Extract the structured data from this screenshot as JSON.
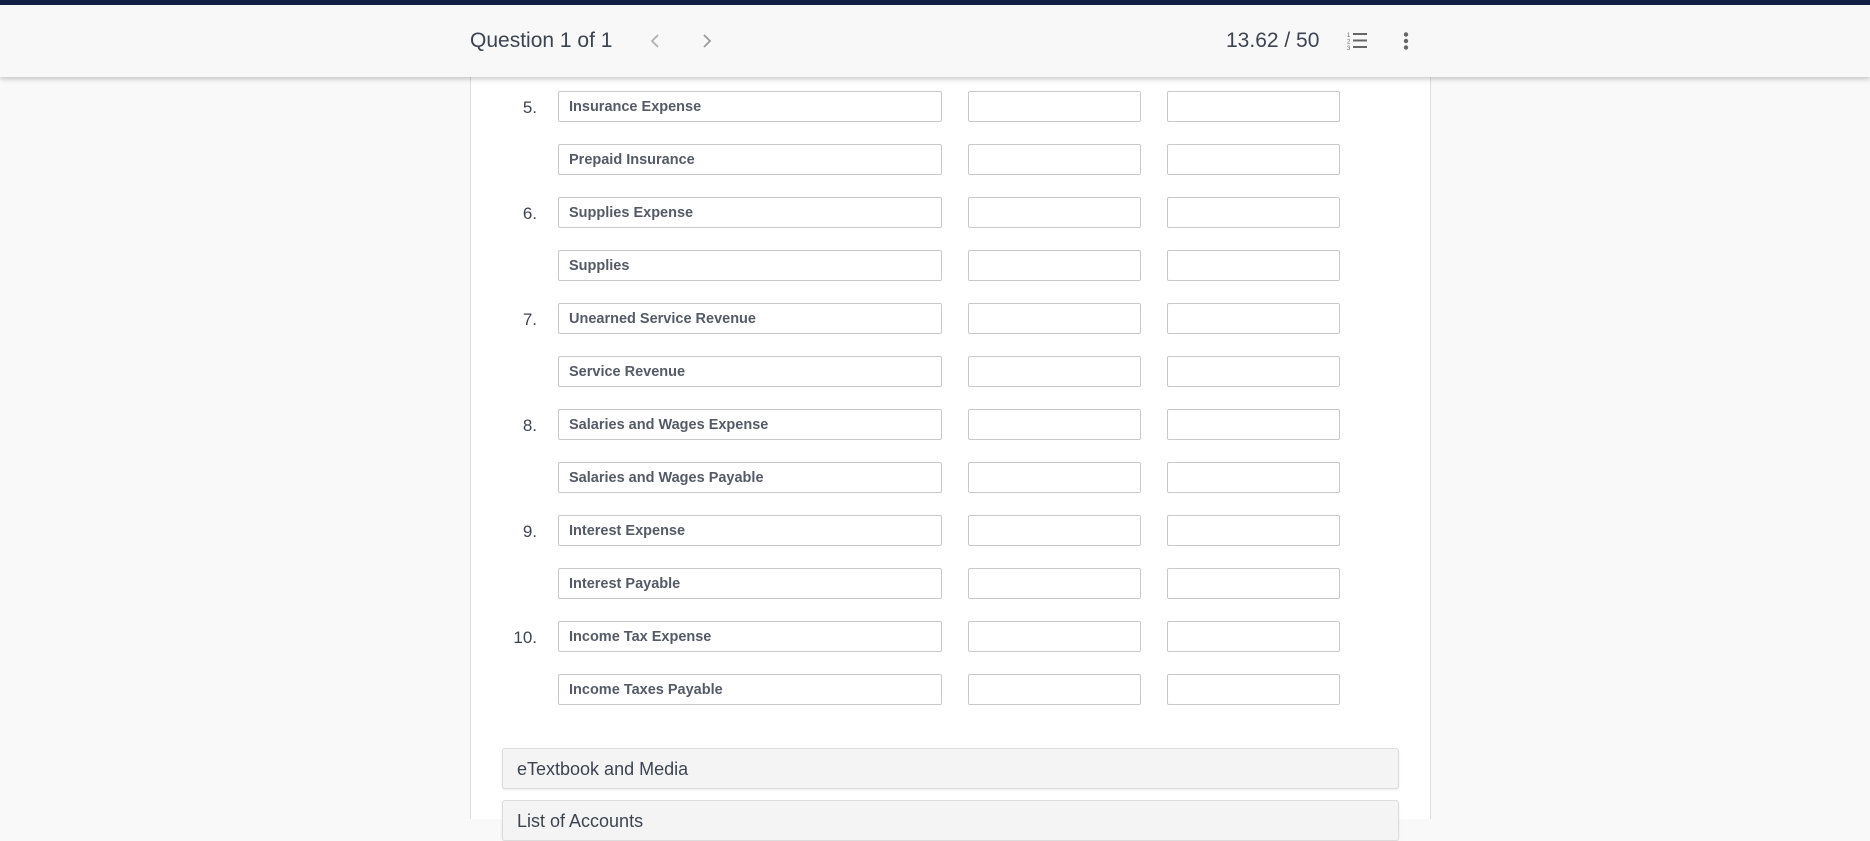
{
  "header": {
    "question_label": "Question 1 of 1",
    "prev_icon": "chevron-left-icon",
    "next_icon": "chevron-right-icon",
    "score": "13.62 / 50",
    "question_list_icon": "numbered-list-icon",
    "more_icon": "vertical-ellipsis-icon"
  },
  "colors": {
    "topbar": "#141f45",
    "text": "#3d4451",
    "input_border": "#c9c9c9"
  },
  "journal_rows": [
    {
      "number": "5.",
      "account": "Insurance Expense",
      "debit": "",
      "credit": ""
    },
    {
      "number": "",
      "account": "Prepaid Insurance",
      "debit": "",
      "credit": ""
    },
    {
      "number": "6.",
      "account": "Supplies Expense",
      "debit": "",
      "credit": ""
    },
    {
      "number": "",
      "account": "Supplies",
      "debit": "",
      "credit": ""
    },
    {
      "number": "7.",
      "account": "Unearned Service Revenue",
      "debit": "",
      "credit": ""
    },
    {
      "number": "",
      "account": "Service Revenue",
      "debit": "",
      "credit": ""
    },
    {
      "number": "8.",
      "account": "Salaries and Wages Expense",
      "debit": "",
      "credit": ""
    },
    {
      "number": "",
      "account": "Salaries and Wages Payable",
      "debit": "",
      "credit": ""
    },
    {
      "number": "9.",
      "account": "Interest Expense",
      "debit": "",
      "credit": ""
    },
    {
      "number": "",
      "account": "Interest Payable",
      "debit": "",
      "credit": ""
    },
    {
      "number": "10.",
      "account": "Income Tax Expense",
      "debit": "",
      "credit": ""
    },
    {
      "number": "",
      "account": "Income Taxes Payable",
      "debit": "",
      "credit": ""
    }
  ],
  "accordions": [
    {
      "label": "eTextbook and Media"
    },
    {
      "label": "List of Accounts"
    }
  ]
}
